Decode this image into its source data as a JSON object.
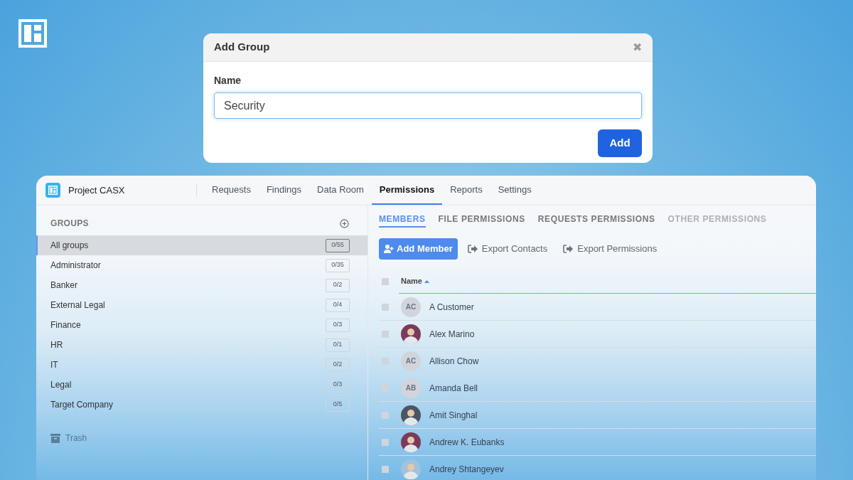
{
  "dialog": {
    "title": "Add Group",
    "close": "✖",
    "field_label": "Name",
    "field_value": "Security",
    "submit": "Add"
  },
  "app": {
    "project": "Project CASX",
    "nav": [
      {
        "label": "Requests",
        "selected": false
      },
      {
        "label": "Findings",
        "selected": false
      },
      {
        "label": "Data Room",
        "selected": false
      },
      {
        "label": "Permissions",
        "selected": true
      },
      {
        "label": "Reports",
        "selected": false
      },
      {
        "label": "Settings",
        "selected": false
      }
    ],
    "sidebar": {
      "heading": "GROUPS",
      "groups": [
        {
          "label": "All groups",
          "count": "0/55",
          "selected": true
        },
        {
          "label": "Administrator",
          "count": "0/35",
          "selected": false
        },
        {
          "label": "Banker",
          "count": "0/2",
          "selected": false
        },
        {
          "label": "External Legal",
          "count": "0/4",
          "selected": false
        },
        {
          "label": "Finance",
          "count": "0/3",
          "selected": false
        },
        {
          "label": "HR",
          "count": "0/1",
          "selected": false
        },
        {
          "label": "IT",
          "count": "0/2",
          "selected": false
        },
        {
          "label": "Legal",
          "count": "0/3",
          "selected": false
        },
        {
          "label": "Target Company",
          "count": "0/5",
          "selected": false
        }
      ],
      "trash": "Trash"
    },
    "subtabs": [
      {
        "label": "MEMBERS",
        "selected": true,
        "disabled": false
      },
      {
        "label": "FILE PERMISSIONS",
        "selected": false,
        "disabled": false
      },
      {
        "label": "REQUESTS PERMISSIONS",
        "selected": false,
        "disabled": false
      },
      {
        "label": "OTHER PERMISSIONS",
        "selected": false,
        "disabled": true
      }
    ],
    "actions": {
      "add_member": "Add Member",
      "export_contacts": "Export Contacts",
      "export_permissions": "Export Permissions"
    },
    "table": {
      "column": "Name",
      "select_all_checked": false,
      "rows": [
        {
          "name": "A Customer",
          "avatar": {
            "kind": "initials",
            "text": "AC"
          },
          "checked": false
        },
        {
          "name": "Alex Marino",
          "avatar": {
            "kind": "photo"
          },
          "checked": false
        },
        {
          "name": "Allison Chow",
          "avatar": {
            "kind": "initials",
            "text": "AC"
          },
          "checked": false
        },
        {
          "name": "Amanda Bell",
          "avatar": {
            "kind": "initials",
            "text": "AB"
          },
          "checked": false
        },
        {
          "name": "Amit Singhal",
          "avatar": {
            "kind": "photo"
          },
          "checked": false
        },
        {
          "name": "Andrew K. Eubanks",
          "avatar": {
            "kind": "photo"
          },
          "checked": false
        },
        {
          "name": "Andrey Shtangeyev",
          "avatar": {
            "kind": "photo"
          },
          "checked": false
        }
      ]
    }
  }
}
